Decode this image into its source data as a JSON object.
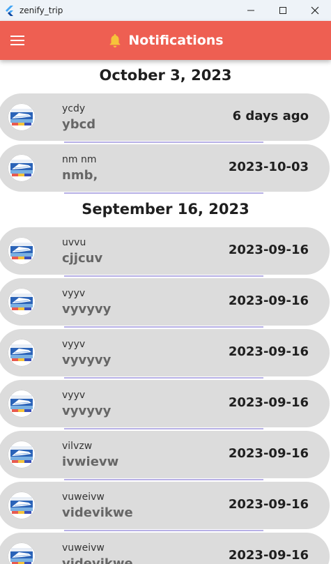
{
  "window": {
    "title": "zenify_trip"
  },
  "appbar": {
    "title": "Notifications"
  },
  "groups": [
    {
      "date": "October 3, 2023",
      "items": [
        {
          "sender": "ycdy",
          "message": "ybcd",
          "time": "6 days ago"
        },
        {
          "sender": "nm nm",
          "message": " nmb,",
          "time": "2023-10-03"
        }
      ]
    },
    {
      "date": "September 16, 2023",
      "items": [
        {
          "sender": "uvvu",
          "message": "cjjcuv",
          "time": "2023-09-16"
        },
        {
          "sender": "vyyv",
          "message": "vyvyvy",
          "time": "2023-09-16"
        },
        {
          "sender": "vyyv",
          "message": "vyvyvy",
          "time": "2023-09-16"
        },
        {
          "sender": "vyyv",
          "message": "vyvyvy",
          "time": "2023-09-16"
        },
        {
          "sender": "vilvzw",
          "message": "ivwievw",
          "time": "2023-09-16"
        },
        {
          "sender": "vuweivw",
          "message": "videvikwe",
          "time": "2023-09-16"
        },
        {
          "sender": "vuweivw",
          "message": "videvikwe",
          "time": "2023-09-16"
        }
      ]
    }
  ],
  "colors": {
    "appbar": "#ee5f52",
    "card": "#dcdcdc",
    "divider": "#b7b0e6",
    "bell": "#f6c33a"
  }
}
